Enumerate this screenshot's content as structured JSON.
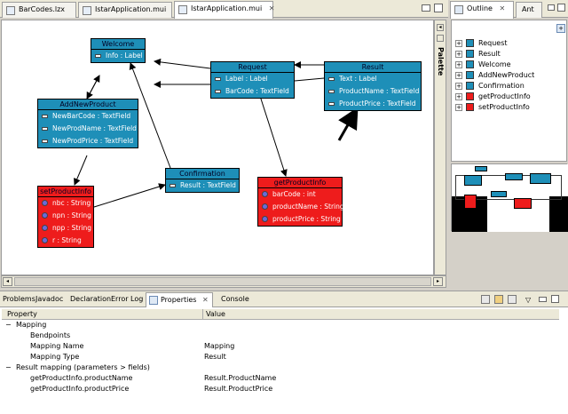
{
  "editor_tabs": [
    {
      "label": "BarCodes.lzx",
      "active": false
    },
    {
      "label": "IstarApplication.mui",
      "active": false
    },
    {
      "label": "IstarApplication.mui",
      "active": true
    }
  ],
  "nodes": {
    "welcome": {
      "title": "Welcome",
      "rows": [
        "Info : Label"
      ]
    },
    "request": {
      "title": "Request",
      "rows": [
        "Label : Label",
        "BarCode : TextField"
      ]
    },
    "result": {
      "title": "Result",
      "rows": [
        "Text : Label",
        "ProductName : TextField",
        "ProductPrice : TextField"
      ]
    },
    "addnewproduct": {
      "title": "AddNewProduct",
      "rows": [
        "NewBarCode : TextField",
        "NewProdName : TextField",
        "NewProdPrice : TextField"
      ]
    },
    "confirmation": {
      "title": "Confirmation",
      "rows": [
        "Result : TextField"
      ]
    },
    "setproductinfo": {
      "title": "setProductInfo",
      "rows": [
        "nbc : String",
        "npn : String",
        "npp : String",
        "r : String"
      ]
    },
    "getproductinfo": {
      "title": "getProductInfo",
      "rows": [
        "barCode : int",
        "productName : String",
        "productPrice : String"
      ]
    }
  },
  "palette": {
    "label": "Palette"
  },
  "outline_tabs": {
    "outline": "Outline",
    "ant": "Ant"
  },
  "outline_items": [
    {
      "label": "Request",
      "color": "#1e8fb8"
    },
    {
      "label": "Result",
      "color": "#1e8fb8"
    },
    {
      "label": "Welcome",
      "color": "#1e8fb8"
    },
    {
      "label": "AddNewProduct",
      "color": "#1e8fb8"
    },
    {
      "label": "Confirmation",
      "color": "#1e8fb8"
    },
    {
      "label": "getProductInfo",
      "color": "#ee1c1c"
    },
    {
      "label": "setProductInfo",
      "color": "#ee1c1c"
    }
  ],
  "bottom_tabs": [
    {
      "label": "Problems"
    },
    {
      "label": "Javadoc"
    },
    {
      "label": "Declaration"
    },
    {
      "label": "Error Log"
    },
    {
      "label": "Properties",
      "active": true
    },
    {
      "label": "Console"
    }
  ],
  "properties": {
    "headers": {
      "property": "Property",
      "value": "Value"
    },
    "rows": [
      {
        "name": "Mapping",
        "value": "",
        "level": 0,
        "expander": "−"
      },
      {
        "name": "Bendpoints",
        "value": "",
        "level": 1
      },
      {
        "name": "Mapping Name",
        "value": "Mapping",
        "level": 1
      },
      {
        "name": "Mapping Type",
        "value": "Result",
        "level": 1
      },
      {
        "name": "Result mapping (parameters > fields)",
        "value": "",
        "level": 0,
        "expander": "−"
      },
      {
        "name": "getProductInfo.productName",
        "value": "Result.ProductName",
        "level": 1
      },
      {
        "name": "getProductInfo.productPrice",
        "value": "Result.ProductPrice",
        "level": 1
      }
    ]
  }
}
